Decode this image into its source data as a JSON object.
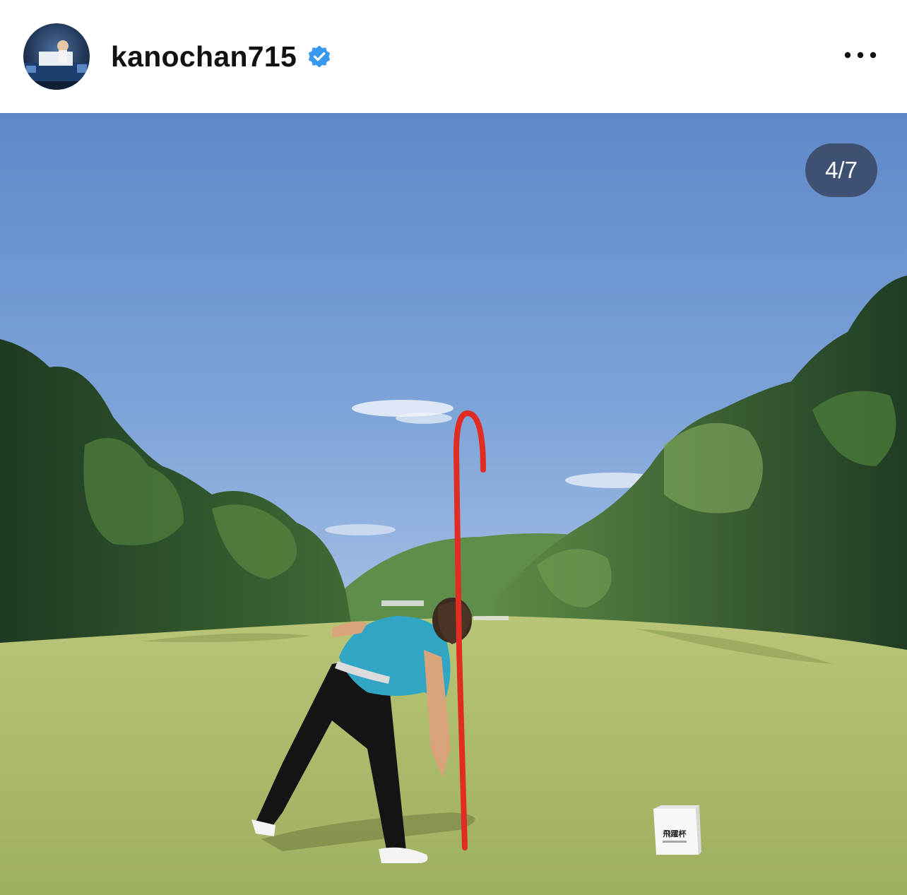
{
  "post": {
    "username": "kanochan715",
    "verified": true,
    "more_icon": "more-horizontal-icon",
    "avatar_icon": "profile-avatar"
  },
  "carousel": {
    "counter": "4/7",
    "current": 4,
    "total": 7
  },
  "photo": {
    "description_icon": "golf-course-photo",
    "marker_text": "飛躍杯",
    "colors": {
      "sky": "#6a92cf",
      "grass": "#a9b96a",
      "shirt": "#30a6c4",
      "trajectory": "#e02c22"
    }
  },
  "colors": {
    "verified_blue": "#3897f0",
    "text": "#111111"
  }
}
